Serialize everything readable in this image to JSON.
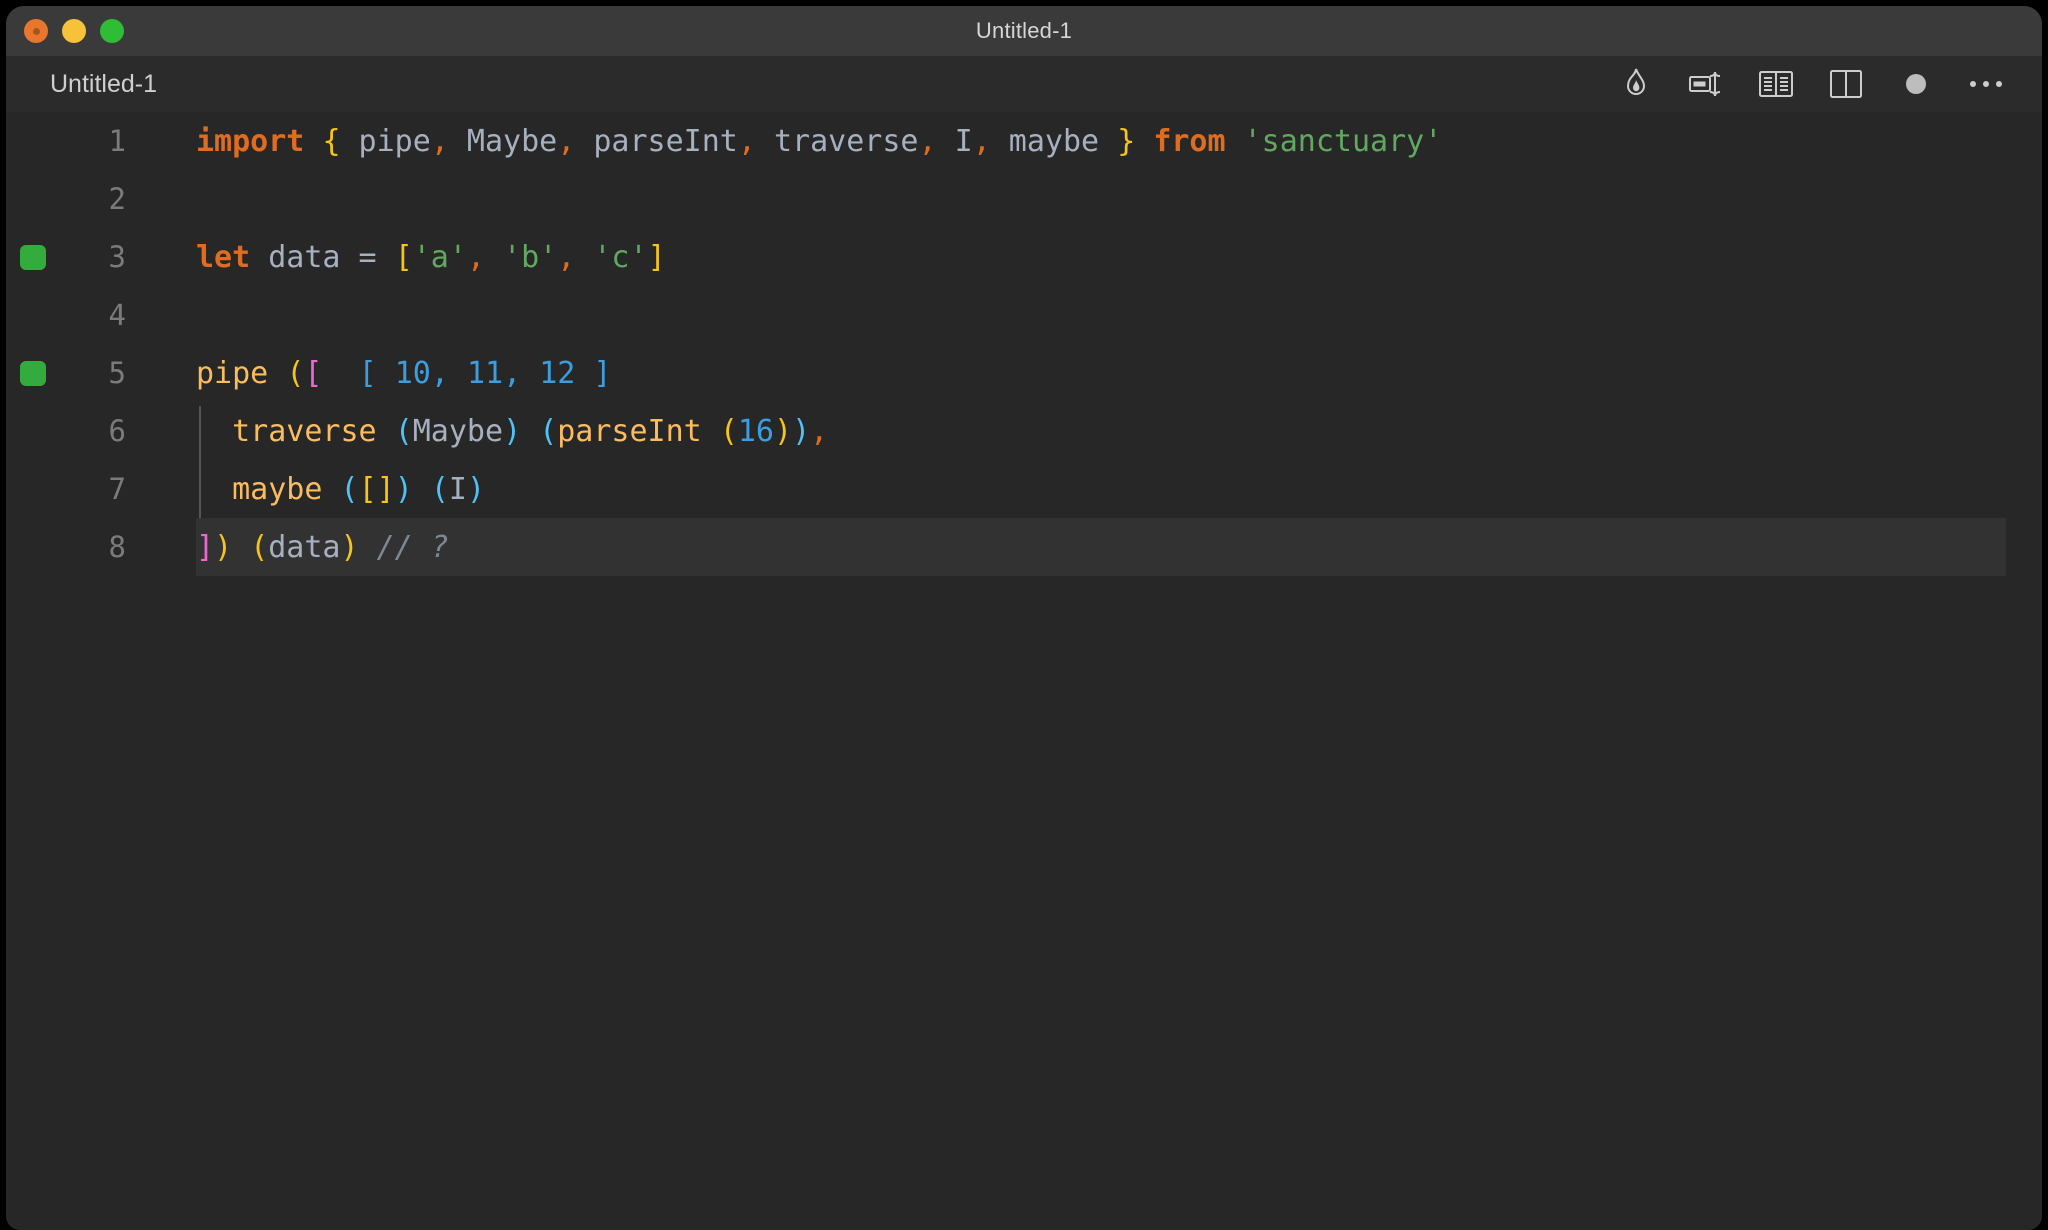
{
  "window": {
    "title": "Untitled-1",
    "traffic_lights": [
      "close-button",
      "minimize-button",
      "maximize-button"
    ]
  },
  "tab": {
    "label": "Untitled-1"
  },
  "toolbar": {
    "items": [
      {
        "icon": "flame-icon",
        "label": "Run Quokka"
      },
      {
        "icon": "run-code-icon",
        "label": "Run Code"
      },
      {
        "icon": "open-preview-icon",
        "label": "Open Preview"
      },
      {
        "icon": "split-editor-icon",
        "label": "Split Editor Right"
      },
      {
        "icon": "unsaved-dot-icon",
        "label": "Unsaved changes"
      },
      {
        "icon": "more-actions-icon",
        "label": "More Actions..."
      }
    ]
  },
  "colors": {
    "background": "#272727",
    "titlebar": "#3a3a3a",
    "tabbar": "#2b2b2b",
    "active_line": "#323232",
    "gutter_added": "#34ac3d",
    "keyword": "#e06c20",
    "identifier": "#a7b0bf",
    "function": "#fbbc5e",
    "string": "#61a860",
    "number": "#3c9ee0",
    "bracket_yellow": "#f5c518",
    "bracket_pink": "#ea68d0",
    "bracket_blue": "#3c9ee0",
    "bracket_cyan": "#4fc3f7",
    "comment": "#7e8794",
    "line_number": "#7b7b7b"
  },
  "editor": {
    "active_line": 8,
    "lines": [
      {
        "number": "1",
        "gutter": "none",
        "tokens": [
          {
            "text": "import",
            "cls": "t-kw"
          },
          {
            "text": " ",
            "cls": "t-plain"
          },
          {
            "text": "{",
            "cls": "t-b-yellow"
          },
          {
            "text": " pipe",
            "cls": "t-id"
          },
          {
            "text": ",",
            "cls": "t-punc"
          },
          {
            "text": " Maybe",
            "cls": "t-id"
          },
          {
            "text": ",",
            "cls": "t-punc"
          },
          {
            "text": " parseInt",
            "cls": "t-id"
          },
          {
            "text": ",",
            "cls": "t-punc"
          },
          {
            "text": " traverse",
            "cls": "t-id"
          },
          {
            "text": ",",
            "cls": "t-punc"
          },
          {
            "text": " I",
            "cls": "t-id"
          },
          {
            "text": ",",
            "cls": "t-punc"
          },
          {
            "text": " maybe ",
            "cls": "t-id"
          },
          {
            "text": "}",
            "cls": "t-b-yellow"
          },
          {
            "text": " ",
            "cls": "t-plain"
          },
          {
            "text": "from",
            "cls": "t-kw"
          },
          {
            "text": " ",
            "cls": "t-plain"
          },
          {
            "text": "'sanctuary'",
            "cls": "t-str"
          }
        ]
      },
      {
        "number": "2",
        "gutter": "none",
        "tokens": []
      },
      {
        "number": "3",
        "gutter": "added",
        "tokens": [
          {
            "text": "let",
            "cls": "t-kw"
          },
          {
            "text": " data = ",
            "cls": "t-id"
          },
          {
            "text": "[",
            "cls": "t-b-yellow"
          },
          {
            "text": "'a'",
            "cls": "t-str"
          },
          {
            "text": ",",
            "cls": "t-punc"
          },
          {
            "text": " ",
            "cls": "t-plain"
          },
          {
            "text": "'b'",
            "cls": "t-str"
          },
          {
            "text": ",",
            "cls": "t-punc"
          },
          {
            "text": " ",
            "cls": "t-plain"
          },
          {
            "text": "'c'",
            "cls": "t-str"
          },
          {
            "text": "]",
            "cls": "t-b-yellow"
          }
        ]
      },
      {
        "number": "4",
        "gutter": "none",
        "tokens": []
      },
      {
        "number": "5",
        "gutter": "added",
        "tokens": [
          {
            "text": "pipe",
            "cls": "t-fn"
          },
          {
            "text": " ",
            "cls": "t-plain"
          },
          {
            "text": "(",
            "cls": "t-b-yellow"
          },
          {
            "text": "[",
            "cls": "t-b-pink"
          },
          {
            "text": "  ",
            "cls": "t-plain"
          },
          {
            "text": "[",
            "cls": "t-b-blue"
          },
          {
            "text": " ",
            "cls": "t-plain"
          },
          {
            "text": "10",
            "cls": "t-num"
          },
          {
            "text": ",",
            "cls": "t-b-blue"
          },
          {
            "text": " ",
            "cls": "t-plain"
          },
          {
            "text": "11",
            "cls": "t-num"
          },
          {
            "text": ",",
            "cls": "t-b-blue"
          },
          {
            "text": " ",
            "cls": "t-plain"
          },
          {
            "text": "12",
            "cls": "t-num"
          },
          {
            "text": " ",
            "cls": "t-plain"
          },
          {
            "text": "]",
            "cls": "t-b-blue"
          }
        ]
      },
      {
        "number": "6",
        "gutter": "none",
        "tokens": [
          {
            "text": "  ",
            "cls": "t-plain"
          },
          {
            "text": "traverse",
            "cls": "t-fn"
          },
          {
            "text": " ",
            "cls": "t-plain"
          },
          {
            "text": "(",
            "cls": "t-b-cyan"
          },
          {
            "text": "Maybe",
            "cls": "t-id"
          },
          {
            "text": ")",
            "cls": "t-b-cyan"
          },
          {
            "text": " ",
            "cls": "t-plain"
          },
          {
            "text": "(",
            "cls": "t-b-cyan"
          },
          {
            "text": "parseInt",
            "cls": "t-fn"
          },
          {
            "text": " ",
            "cls": "t-plain"
          },
          {
            "text": "(",
            "cls": "t-b-yellow"
          },
          {
            "text": "16",
            "cls": "t-num"
          },
          {
            "text": ")",
            "cls": "t-b-yellow"
          },
          {
            "text": ")",
            "cls": "t-b-cyan"
          },
          {
            "text": ",",
            "cls": "t-punc"
          }
        ]
      },
      {
        "number": "7",
        "gutter": "none",
        "tokens": [
          {
            "text": "  ",
            "cls": "t-plain"
          },
          {
            "text": "maybe",
            "cls": "t-fn"
          },
          {
            "text": " ",
            "cls": "t-plain"
          },
          {
            "text": "(",
            "cls": "t-b-cyan"
          },
          {
            "text": "[]",
            "cls": "t-b-yellow"
          },
          {
            "text": ")",
            "cls": "t-b-cyan"
          },
          {
            "text": " ",
            "cls": "t-plain"
          },
          {
            "text": "(",
            "cls": "t-b-cyan"
          },
          {
            "text": "I",
            "cls": "t-id"
          },
          {
            "text": ")",
            "cls": "t-b-cyan"
          }
        ]
      },
      {
        "number": "8",
        "gutter": "none",
        "tokens": [
          {
            "text": "]",
            "cls": "t-b-pink"
          },
          {
            "text": ")",
            "cls": "t-b-yellow"
          },
          {
            "text": " ",
            "cls": "t-plain"
          },
          {
            "text": "(",
            "cls": "t-b-yellow"
          },
          {
            "text": "data",
            "cls": "t-id"
          },
          {
            "text": ")",
            "cls": "t-b-yellow"
          },
          {
            "text": " ",
            "cls": "t-plain"
          },
          {
            "text": "// ?",
            "cls": "t-comment"
          }
        ]
      }
    ]
  }
}
